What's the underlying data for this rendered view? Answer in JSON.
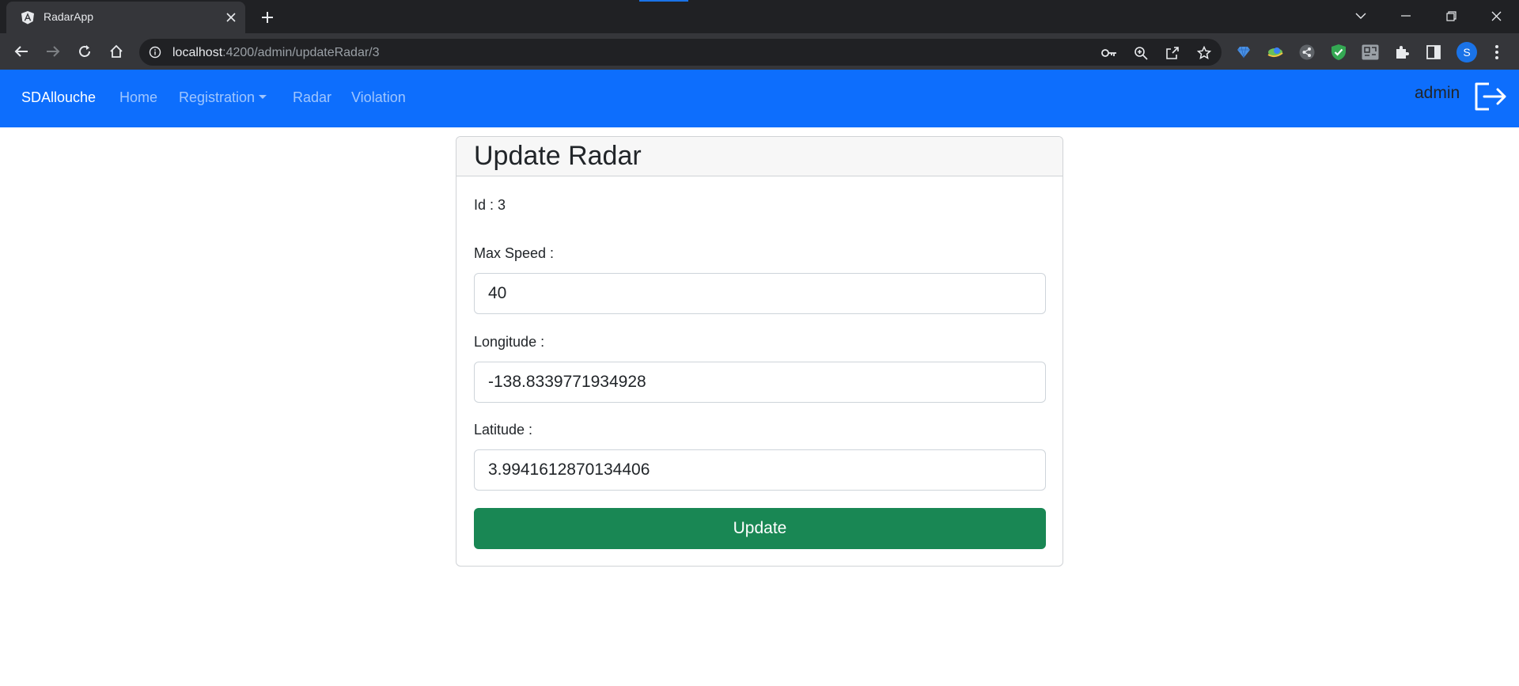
{
  "browser": {
    "tab_title": "RadarApp",
    "url_host": "localhost",
    "url_path": ":4200/admin/updateRadar/3",
    "profile_initial": "S",
    "extension_icons": [
      "key-icon",
      "zoom-icon",
      "share-icon",
      "star-icon",
      "diamond-extension-icon",
      "globe-extension-icon",
      "share-extension-icon",
      "shield-extension-icon",
      "qr-extension-icon",
      "puzzle-icon",
      "side-panel-icon"
    ]
  },
  "navbar": {
    "brand": "SDAllouche",
    "links": {
      "home": "Home",
      "registration": "Registration",
      "radar": "Radar",
      "violation": "Violation"
    },
    "user": "admin"
  },
  "card": {
    "title": "Update Radar",
    "id_text": "Id : 3",
    "max_speed_label": "Max Speed :",
    "max_speed_value": "40",
    "longitude_label": "Longitude :",
    "longitude_value": "-138.8339771934928",
    "latitude_label": "Latitude :",
    "latitude_value": "3.9941612870134406",
    "update_label": "Update"
  },
  "colors": {
    "navbar": "#0d6efd",
    "update_button": "#198754"
  }
}
